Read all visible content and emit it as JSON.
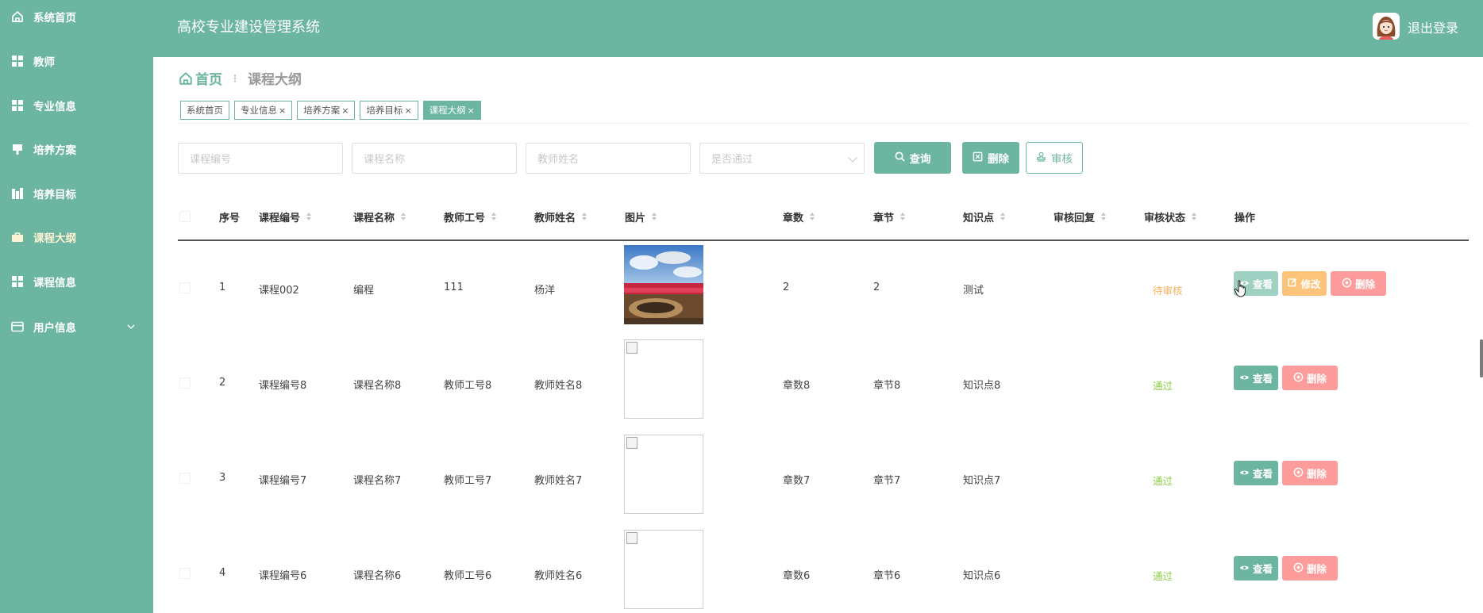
{
  "app": {
    "title": "高校专业建设管理系统",
    "logout": "退出登录"
  },
  "sidebar": {
    "items": [
      {
        "label": "系统首页",
        "icon": "home-icon"
      },
      {
        "label": "教师",
        "icon": "grid-icon"
      },
      {
        "label": "专业信息",
        "icon": "grid-icon"
      },
      {
        "label": "培养方案",
        "icon": "bookmark-icon"
      },
      {
        "label": "培养目标",
        "icon": "chart-icon"
      },
      {
        "label": "课程大纲",
        "icon": "briefcase-icon",
        "active": true
      },
      {
        "label": "课程信息",
        "icon": "grid-icon"
      },
      {
        "label": "用户信息",
        "icon": "card-icon"
      }
    ]
  },
  "breadcrumb": {
    "home": "首页",
    "current": "课程大纲"
  },
  "tags": [
    {
      "label": "系统首页",
      "closable": false
    },
    {
      "label": "专业信息",
      "closable": true
    },
    {
      "label": "培养方案",
      "closable": true
    },
    {
      "label": "培养目标",
      "closable": true
    },
    {
      "label": "课程大纲",
      "closable": true,
      "active": true
    }
  ],
  "search": {
    "course_code_placeholder": "课程编号",
    "course_name_placeholder": "课程名称",
    "teacher_name_placeholder": "教师姓名",
    "passed_placeholder": "是否通过",
    "query_label": "查询",
    "delete_label": "删除",
    "review_label": "审核"
  },
  "table": {
    "columns": [
      "序号",
      "课程编号",
      "课程名称",
      "教师工号",
      "教师姓名",
      "图片",
      "章数",
      "章节",
      "知识点",
      "审核回复",
      "审核状态",
      "操作"
    ],
    "rows": [
      {
        "index": "1",
        "code": "课程002",
        "name": "编程",
        "teacher_no": "111",
        "teacher_name": "杨洋",
        "image": "photo",
        "chapters": "2",
        "section": "2",
        "knowledge": "测试",
        "reply": "",
        "status": "待审核",
        "status_type": "pending"
      },
      {
        "index": "2",
        "code": "课程编号8",
        "name": "课程名称8",
        "teacher_no": "教师工号8",
        "teacher_name": "教师姓名8",
        "image": "broken",
        "chapters": "章数8",
        "section": "章节8",
        "knowledge": "知识点8",
        "reply": "",
        "status": "通过",
        "status_type": "pass"
      },
      {
        "index": "3",
        "code": "课程编号7",
        "name": "课程名称7",
        "teacher_no": "教师工号7",
        "teacher_name": "教师姓名7",
        "image": "broken",
        "chapters": "章数7",
        "section": "章节7",
        "knowledge": "知识点7",
        "reply": "",
        "status": "通过",
        "status_type": "pass"
      },
      {
        "index": "4",
        "code": "课程编号6",
        "name": "课程名称6",
        "teacher_no": "教师工号6",
        "teacher_name": "教师姓名6",
        "image": "broken",
        "chapters": "章数6",
        "section": "章节6",
        "knowledge": "知识点6",
        "reply": "",
        "status": "通过",
        "status_type": "pass"
      }
    ],
    "actions": {
      "view": "查看",
      "edit": "修改",
      "delete": "删除"
    }
  },
  "colors": {
    "primary": "#6bb5a1",
    "warning": "#fbc47a",
    "danger": "#fe9b9b",
    "pending": "#f7b25f",
    "pass": "#8fcd4a"
  }
}
